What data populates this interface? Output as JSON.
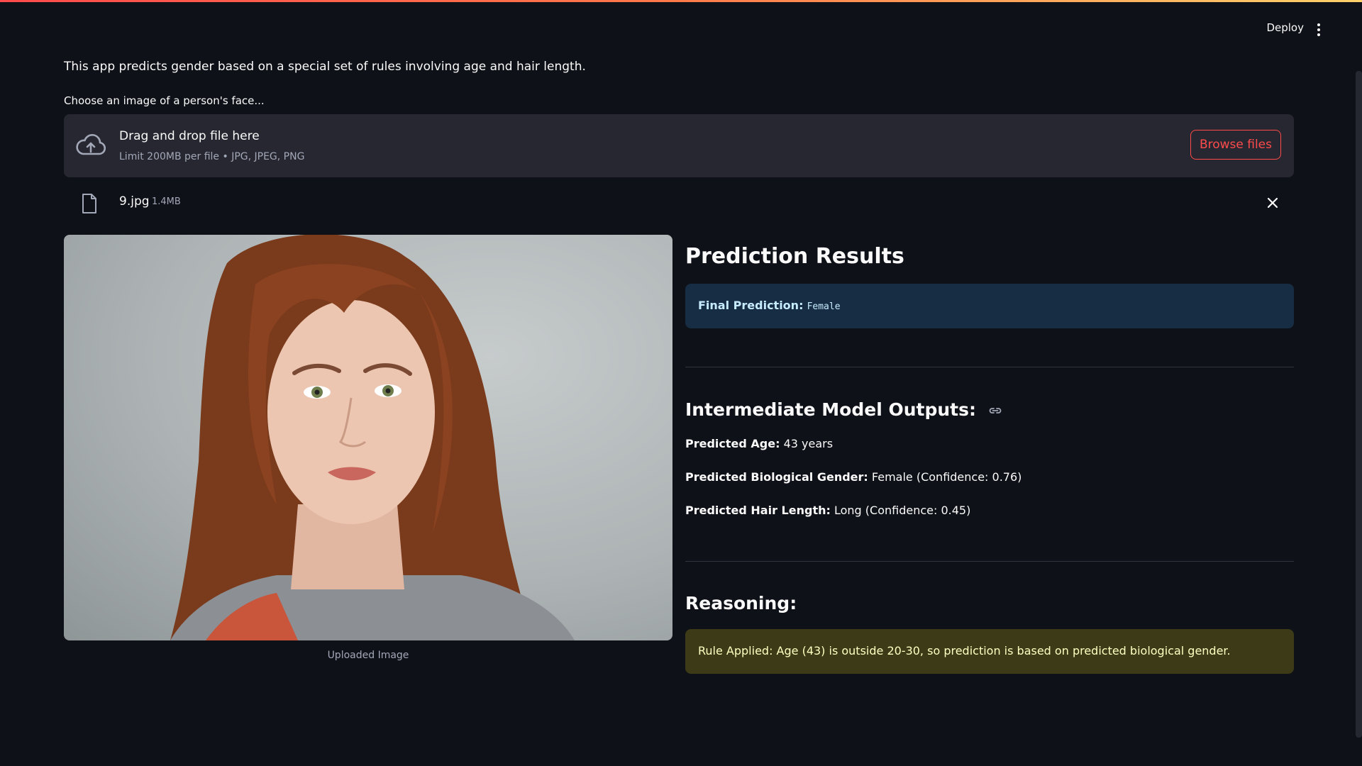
{
  "header": {
    "deploy_label": "Deploy",
    "menu_icon": "kebab-menu-icon"
  },
  "intro_text": "This app predicts gender based on a special set of rules involving age and hair length.",
  "uploader": {
    "label": "Choose an image of a person's face...",
    "drop_title": "Drag and drop file here",
    "drop_subtitle": "Limit 200MB per file • JPG, JPEG, PNG",
    "browse_label": "Browse files",
    "icon": "cloud-upload-icon"
  },
  "uploaded_file": {
    "name": "9.jpg",
    "size": "1.4MB",
    "icon": "file-icon"
  },
  "image": {
    "caption": "Uploaded Image"
  },
  "results": {
    "title": "Prediction Results",
    "final_label": "Final Prediction:",
    "final_value": "Female",
    "intermediate_title": "Intermediate Model Outputs:",
    "age_label": "Predicted Age:",
    "age_value": "43 years",
    "gender_label": "Predicted Biological Gender:",
    "gender_value": "Female (Confidence: 0.76)",
    "hair_label": "Predicted Hair Length:",
    "hair_value": "Long (Confidence: 0.45)",
    "reasoning_title": "Reasoning:",
    "reasoning_text": "Rule Applied: Age (43) is outside 20-30, so prediction is based on predicted biological gender."
  },
  "colors": {
    "background": "#0e1117",
    "accent": "#ff4b4b",
    "info_bg": "#172d43",
    "warning_bg": "#3d3b17"
  }
}
